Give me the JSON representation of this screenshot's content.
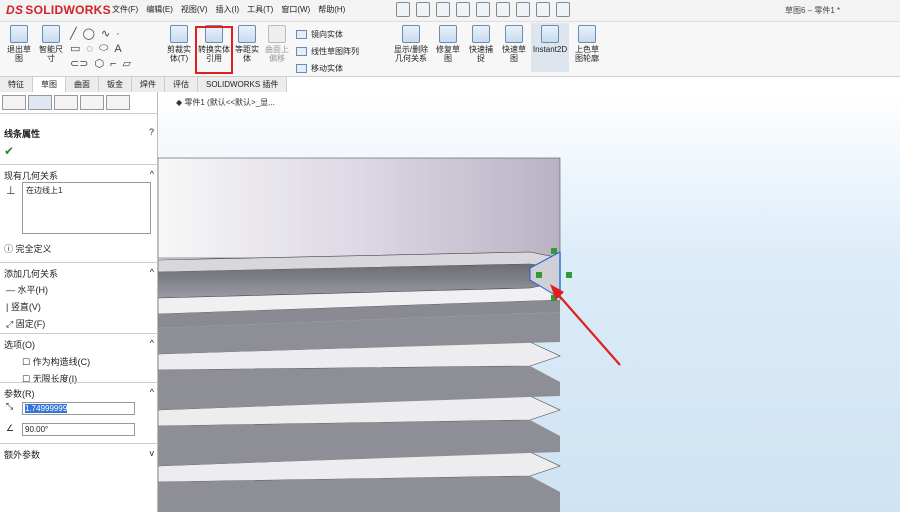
{
  "app": {
    "logo_mark": "DS",
    "logo": "SOLIDWORKS",
    "window_title": "草图6 – 零件1 *"
  },
  "menu": [
    "文件(F)",
    "编辑(E)",
    "视图(V)",
    "插入(I)",
    "工具(T)",
    "窗口(W)",
    "帮助(H)"
  ],
  "ribbon": {
    "exit_sketch": "退出草图",
    "smart_dim": "智能尺寸",
    "trim": "剪裁实体(T)",
    "convert": "转换实体引用",
    "offset": "等距实体",
    "surface_offset": "曲面上偏移",
    "mirror": "镜向实体",
    "linear_pattern": "线性草图阵列",
    "move": "移动实体",
    "show_relations": "显示/删除几何关系",
    "repair": "修复草图",
    "quick_snap": "快速捕捉",
    "fast_sketch": "快速草图",
    "instant2d": "Instant2D",
    "color_contour": "上色草图轮廓"
  },
  "tabs": [
    "特征",
    "草图",
    "曲面",
    "钣金",
    "焊件",
    "评估",
    "SOLIDWORKS 插件"
  ],
  "active_tab": "草图",
  "panel": {
    "title": "线条属性",
    "existing_relations": "现有几何关系",
    "relation_item": "在边线上1",
    "status": "完全定义",
    "add_relations": "添加几何关系",
    "horizontal": "水平(H)",
    "vertical": "竖直(V)",
    "fix": "固定(F)",
    "options": "选项(O)",
    "construction": "作为构造线(C)",
    "infinite": "无限长度(I)",
    "parameters": "参数(R)",
    "length": "1.74999999",
    "angle": "90.00°",
    "extra": "额外参数"
  },
  "viewport": {
    "crumb": "零件1 (默认<<默认>_显..."
  },
  "colors": {
    "accent": "#e02020",
    "selection": "#3475d6"
  }
}
